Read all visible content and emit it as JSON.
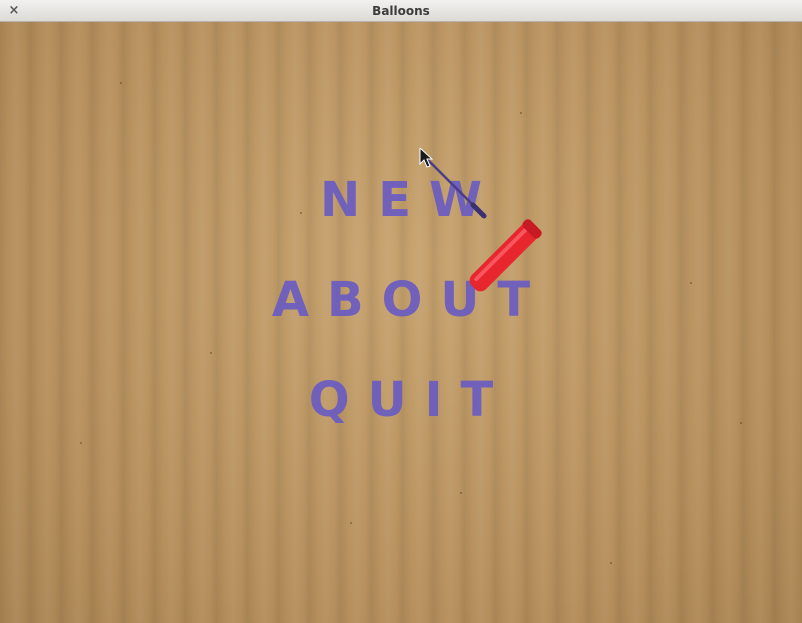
{
  "window": {
    "title": "Balloons",
    "close_glyph": "×"
  },
  "menu": {
    "new_label": "NEW",
    "about_label": "ABOUT",
    "quit_label": "QUIT"
  },
  "colors": {
    "menu_text": "#6a5cc2",
    "background": "#b89462",
    "screwdriver_handle": "#e8262e"
  },
  "icons": {
    "cursor": "screwdriver-cursor-icon",
    "close": "close-icon"
  }
}
